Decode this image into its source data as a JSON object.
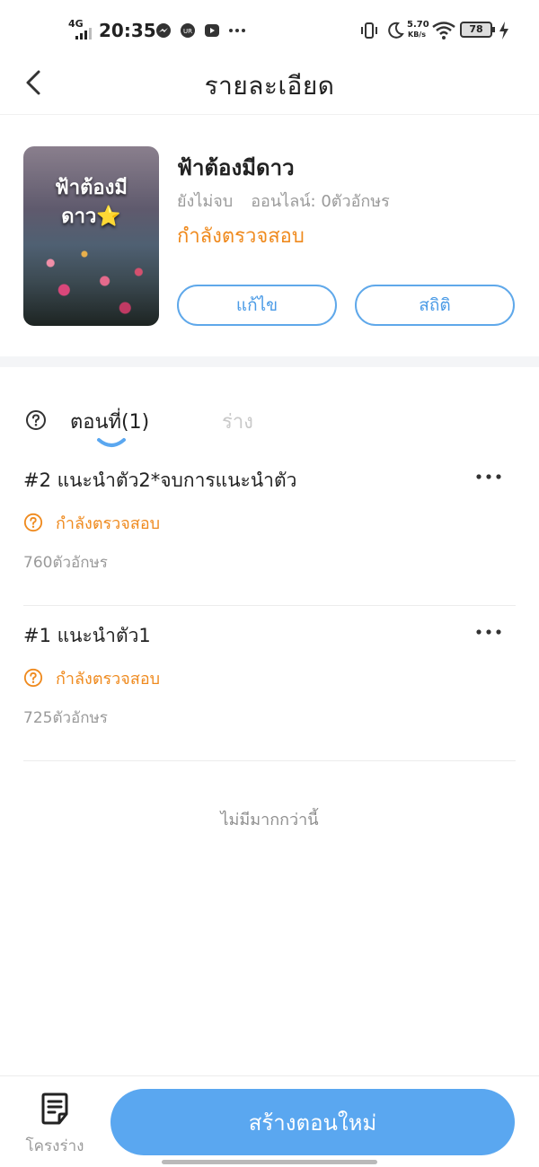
{
  "status_bar": {
    "network": "4G",
    "time": "20:35",
    "speed_value": "5.70",
    "speed_unit": "KB/s",
    "battery": "78"
  },
  "header": {
    "title": "รายละเอียด"
  },
  "book": {
    "cover_text_line1": "ฟ้าต้องมี",
    "cover_text_line2": "ดาว⭐",
    "title": "ฟ้าต้องมีดาว",
    "completion": "ยังไม่จบ",
    "online": "ออนไลน์: 0ตัวอักษร",
    "status": "กำลังตรวจสอบ",
    "edit_label": "แก้ไข",
    "stats_label": "สถิติ"
  },
  "tabs": {
    "episodes_label": "ตอนที่(1)",
    "draft_label": "ร่าง"
  },
  "episodes": [
    {
      "title": "#2  แนะนำตัว2*จบการแนะนำตัว",
      "status": "กำลังตรวจสอบ",
      "count": "760ตัวอักษร"
    },
    {
      "title": "#1  แนะนำตัว1",
      "status": "กำลังตรวจสอบ",
      "count": "725ตัวอักษร"
    }
  ],
  "list_end": "ไม่มีมากกว่านี้",
  "bottom": {
    "outline_label": "โครงร่าง",
    "create_label": "สร้างตอนใหม่"
  },
  "colors": {
    "accent": "#5aa7f0",
    "status_orange": "#ef8a1e"
  }
}
